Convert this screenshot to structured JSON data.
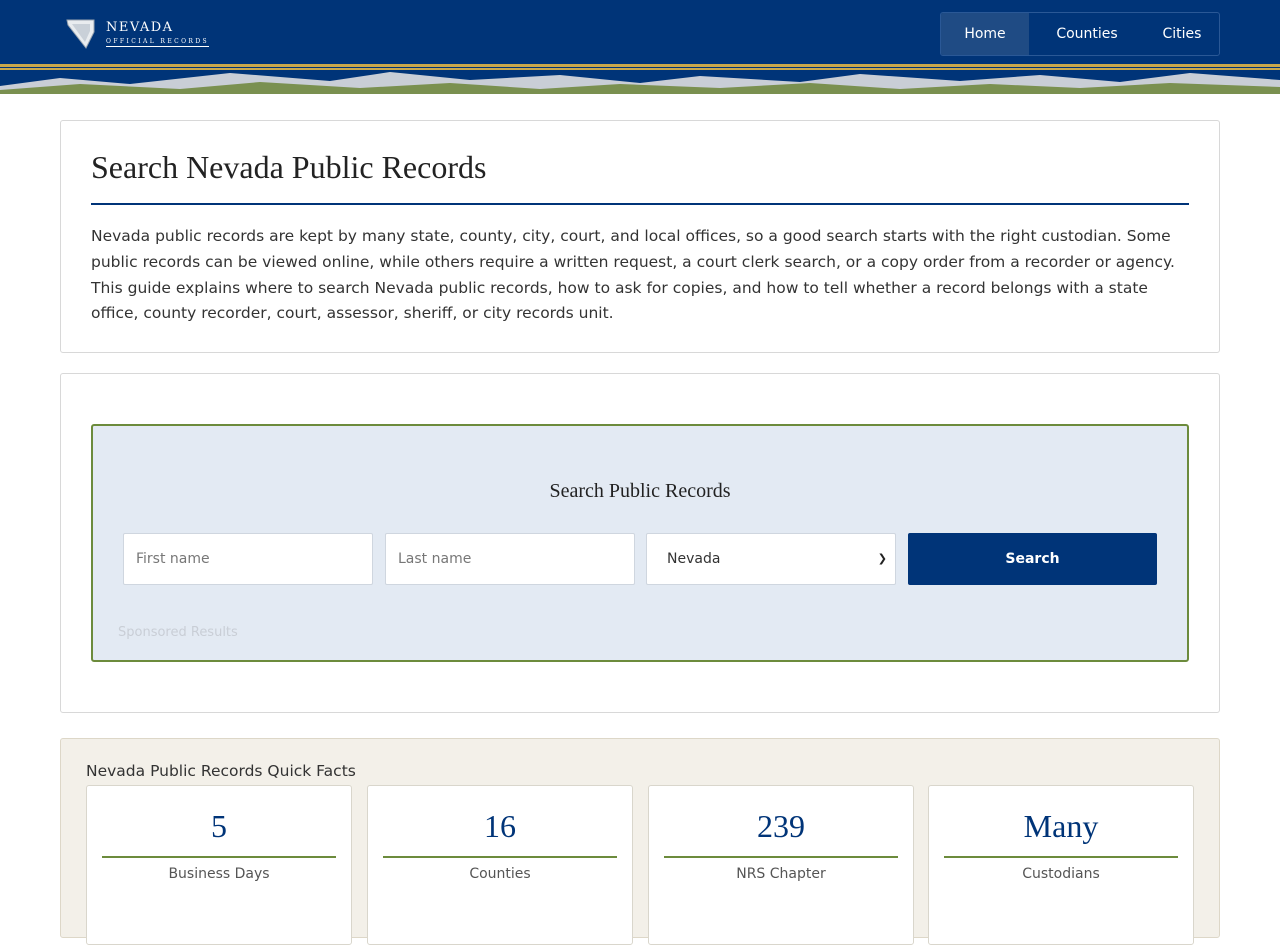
{
  "header": {
    "logo_title": "NEVADA",
    "logo_subtitle": "OFFICIAL RECORDS",
    "nav": [
      {
        "label": "Home",
        "active": true
      },
      {
        "label": "Counties",
        "active": false
      },
      {
        "label": "Cities",
        "active": false
      }
    ]
  },
  "intro": {
    "title": "Search Nevada Public Records",
    "text": "Nevada public records are kept by many state, county, city, court, and local offices, so a good search starts with the right custodian. Some public records can be viewed online, while others require a written request, a court clerk search, or a copy order from a recorder or agency. This guide explains where to search Nevada public records, how to ask for copies, and how to tell whether a record belongs with a state office, county recorder, court, assessor, sheriff, or city records unit."
  },
  "search": {
    "heading": "Search Public Records",
    "first_name_placeholder": "First name",
    "last_name_placeholder": "Last name",
    "state_selected": "Nevada",
    "button_label": "Search",
    "sponsored_label": "Sponsored Results"
  },
  "facts": {
    "title": "Nevada Public Records Quick Facts",
    "items": [
      {
        "value": "5",
        "label": "Business Days"
      },
      {
        "value": "16",
        "label": "Counties"
      },
      {
        "value": "239",
        "label": "NRS Chapter"
      },
      {
        "value": "Many",
        "label": "Custodians"
      }
    ]
  },
  "colors": {
    "navy": "#003478",
    "green": "#6c8b3c",
    "gold": "#c9a84c",
    "panel": "#e3eaf3"
  }
}
